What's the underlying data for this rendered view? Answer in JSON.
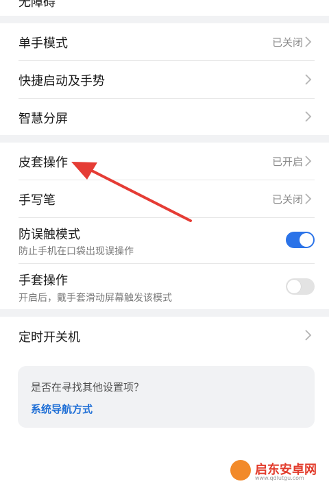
{
  "top_item": {
    "title": "无障碍"
  },
  "group1": [
    {
      "title": "单手模式",
      "value": "已关闭"
    },
    {
      "title": "快捷启动及手势",
      "value": ""
    },
    {
      "title": "智慧分屏",
      "value": ""
    }
  ],
  "group2": {
    "cover": {
      "title": "皮套操作",
      "value": "已开启"
    },
    "pen": {
      "title": "手写笔",
      "value": "已关闭"
    },
    "pocket": {
      "title": "防误触模式",
      "subtitle": "防止手机在口袋出现误操作",
      "toggle": "on"
    },
    "glove": {
      "title": "手套操作",
      "subtitle": "开启后，戴手套滑动屏幕触发该模式",
      "toggle": "off"
    }
  },
  "group3": {
    "title": "定时开关机"
  },
  "suggest": {
    "question": "是否在寻找其他设置项？",
    "link": "系统导航方式"
  },
  "watermark": {
    "name": "启东安卓网",
    "url": "www.qdlutgu.com"
  },
  "colors": {
    "accent": "#2b73e8",
    "link": "#1f6fd6",
    "separator": "#f1f2f4",
    "arrow": "#e53c35"
  }
}
